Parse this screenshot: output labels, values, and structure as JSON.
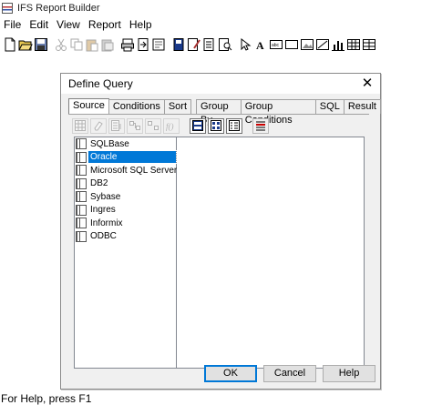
{
  "app": {
    "title": "IFS Report Builder"
  },
  "menu": [
    "File",
    "Edit",
    "View",
    "Report",
    "Help"
  ],
  "dialog": {
    "title": "Define Query",
    "close_glyph": "✕",
    "tabs": [
      "Source",
      "Conditions",
      "Sort",
      "Group By",
      "Group Conditions",
      "SQL",
      "Result"
    ],
    "active_tab": "Source",
    "sources": [
      "SQLBase",
      "Oracle",
      "Microsoft SQL Server",
      "DB2",
      "Sybase",
      "Ingres",
      "Informix",
      "ODBC"
    ],
    "selected_source": "Oracle",
    "buttons": {
      "ok": "OK",
      "cancel": "Cancel",
      "help": "Help"
    }
  },
  "status": {
    "text": "For Help, press F1"
  }
}
